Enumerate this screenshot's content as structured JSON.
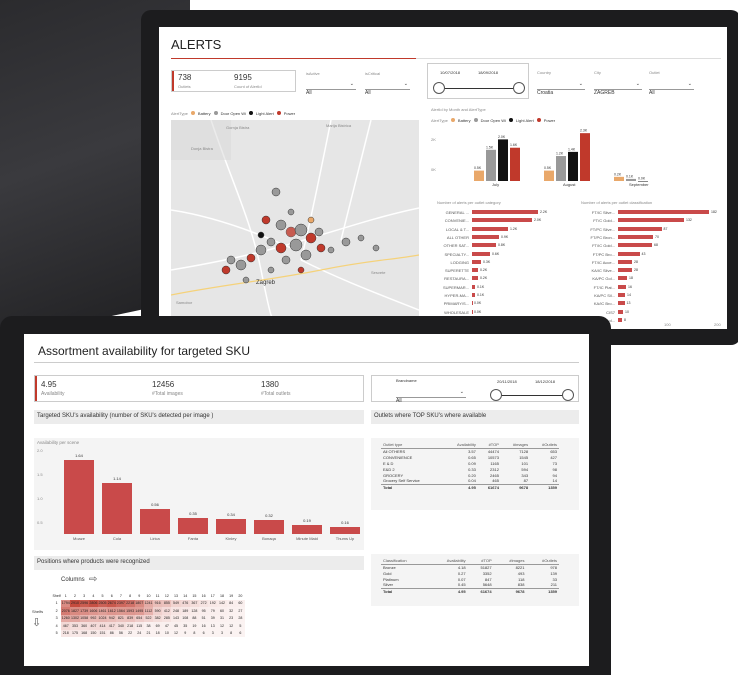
{
  "alerts": {
    "title": "ALERTS",
    "kpi1_value": "738",
    "kpi1_label": "Outlets",
    "kpi2_value": "9195",
    "kpi2_label": "Count of AlertId",
    "filters": [
      {
        "label": "isActive",
        "value": "All"
      },
      {
        "label": "isCritical",
        "value": "All"
      }
    ],
    "date_from": "10/07/2018",
    "date_to": "18/09/2018",
    "country_label": "Country",
    "country_value": "Croatia",
    "city_label": "City",
    "city_value": "ZAGREB",
    "outlet_label": "Outlet",
    "outlet_value": "All",
    "alert_type_label": "AlertType",
    "legend": [
      "Battery",
      "Door Open Wi",
      "Light Alert",
      "Power"
    ],
    "legend_colors": [
      "#e9a86a",
      "#999999",
      "#111111",
      "#c0392b"
    ],
    "map_places": [
      "Gornja Bistra",
      "Donja Bistra",
      "Marija Bistrica",
      "Sesvete",
      "Zagreb",
      "Velika Gorica",
      "Samobor"
    ],
    "month_chart_title": "AlertId by Month and AlertType",
    "months": [
      "July",
      "August",
      "September"
    ],
    "month_values": [
      [
        "0.5K",
        "1.5K",
        "2.0K",
        "1.6K"
      ],
      [
        "0.5K",
        "1.2K",
        "1.4K",
        "2.3K"
      ],
      [
        "0.2K",
        "0.1K",
        "0.0K",
        ""
      ]
    ],
    "month_axis": [
      "2K",
      "0K"
    ],
    "cat_title": "Number of alerts per outlet category",
    "categories": [
      {
        "name": "GENERAL ...",
        "value": 2.2,
        "label": "2.2K"
      },
      {
        "name": "CONVENIE...",
        "value": 2.0,
        "label": "2.0K"
      },
      {
        "name": "LOCAL & T...",
        "value": 1.2,
        "label": "1.2K"
      },
      {
        "name": "ALL OTHER",
        "value": 0.9,
        "label": "0.9K"
      },
      {
        "name": "OTHER SAT...",
        "value": 0.8,
        "label": "0.8K"
      },
      {
        "name": "SPECIALTY...",
        "value": 0.6,
        "label": "0.6K"
      },
      {
        "name": "LODGING",
        "value": 0.3,
        "label": "0.3K"
      },
      {
        "name": "SUPERETTE",
        "value": 0.2,
        "label": "0.2K"
      },
      {
        "name": "RESTAURA...",
        "value": 0.2,
        "label": "0.2K"
      },
      {
        "name": "SUPERMAR...",
        "value": 0.1,
        "label": "0.1K"
      },
      {
        "name": "HYPER-MA...",
        "value": 0.1,
        "label": "0.1K"
      },
      {
        "name": "PRIMARY/S...",
        "value": 0.0,
        "label": "0.0K"
      },
      {
        "name": "WHOLESALE",
        "value": 0.0,
        "label": "0.0K"
      }
    ],
    "class_title": "Number of alerts per outlet classification",
    "classes": [
      {
        "name": "FT/IC Silve...",
        "value": 182,
        "label": "182"
      },
      {
        "name": "FT/C Gold...",
        "value": 132,
        "label": "132"
      },
      {
        "name": "FT/PC Silve...",
        "value": 87,
        "label": "87"
      },
      {
        "name": "FT/PC Bron...",
        "value": 70,
        "label": "70"
      },
      {
        "name": "FT/IC Gold...",
        "value": 68,
        "label": "68"
      },
      {
        "name": "FT/PC Bro...",
        "value": 43,
        "label": "43"
      },
      {
        "name": "FT/IC Acce...",
        "value": 28,
        "label": "28"
      },
      {
        "name": "KA/IC Silve...",
        "value": 28,
        "label": "28"
      },
      {
        "name": "KA/PC Gol...",
        "value": 18,
        "label": "18"
      },
      {
        "name": "FT/IC Plat...",
        "value": 16,
        "label": "16"
      },
      {
        "name": "KA/PC Sil...",
        "value": 14,
        "label": "14"
      },
      {
        "name": "KA/IC Bro...",
        "value": 13,
        "label": "13"
      },
      {
        "name": "CIS7",
        "value": 10,
        "label": "10"
      },
      {
        "name": "KA/IC Gol...",
        "value": 8,
        "label": "8"
      }
    ],
    "class_axis": [
      "100",
      "200"
    ]
  },
  "assort": {
    "title": "Assortment availability for targeted SKU",
    "kpi1_value": "4.95",
    "kpi1_label": "Availability",
    "kpi2_value": "12456",
    "kpi2_label": "#Total images",
    "kpi3_value": "1380",
    "kpi3_label": "#Total outlets",
    "brand_label": "Brandname",
    "brand_value": "All",
    "date_from": "20/11/2018",
    "date_to": "18/12/2018",
    "avail_section": "Targeted SKU's availability (number of SKU's detected per image )",
    "outlets_section": "Outlets where TOP SKU's where available",
    "avail_chart_title": "Availability per scene",
    "y_ticks": [
      "2.0",
      "1.5",
      "1.0",
      "0.5",
      "0.0"
    ],
    "skus": [
      {
        "name": "Moaze",
        "value": 1.64,
        "label": "1.64"
      },
      {
        "name": "Cola",
        "value": 1.14,
        "label": "1.14"
      },
      {
        "name": "Lirica",
        "value": 0.56,
        "label": "0.56"
      },
      {
        "name": "Fanta",
        "value": 0.35,
        "label": "0.35"
      },
      {
        "name": "Kinley",
        "value": 0.34,
        "label": "0.34"
      },
      {
        "name": "Bonaqa",
        "value": 0.32,
        "label": "0.32"
      },
      {
        "name": "Minute Maid",
        "value": 0.19,
        "label": "0.19"
      },
      {
        "name": "Thums Up",
        "value": 0.16,
        "label": "0.16"
      }
    ],
    "positions_section": "Positions where products were recognized",
    "columns_label": "Columns",
    "shelfs_label": "Shelfs",
    "shelf_header": "Shelf",
    "grid_cols": [
      "1",
      "2",
      "3",
      "4",
      "5",
      "6",
      "7",
      "8",
      "9",
      "10",
      "11",
      "12",
      "13",
      "14",
      "15",
      "16",
      "17",
      "18",
      "19",
      "20"
    ],
    "grid_rows": [
      {
        "shelf": "1",
        "values": [
          "1794",
          "2910",
          "2596",
          "2806",
          "2505",
          "2674",
          "2397",
          "2218",
          "1807",
          "1241",
          "916",
          "855",
          "549",
          "476",
          "367",
          "272",
          "192",
          "142",
          "84",
          "60"
        ]
      },
      {
        "shelf": "2",
        "values": [
          "2076",
          "1827",
          "1739",
          "1606",
          "1461",
          "1612",
          "1564",
          "1593",
          "1495",
          "1112",
          "590",
          "412",
          "248",
          "189",
          "128",
          "95",
          "79",
          "60",
          "32",
          "27"
        ]
      },
      {
        "shelf": "3",
        "values": [
          "1260",
          "1302",
          "1058",
          "992",
          "1024",
          "942",
          "821",
          "839",
          "654",
          "522",
          "382",
          "285",
          "143",
          "108",
          "88",
          "51",
          "39",
          "31",
          "23",
          "28"
        ]
      },
      {
        "shelf": "4",
        "values": [
          "467",
          "353",
          "360",
          "407",
          "414",
          "417",
          "340",
          "218",
          "115",
          "38",
          "69",
          "47",
          "45",
          "35",
          "19",
          "16",
          "13",
          "12",
          "12",
          "5"
        ]
      },
      {
        "shelf": "5",
        "values": [
          "218",
          "175",
          "168",
          "150",
          "151",
          "86",
          "56",
          "22",
          "24",
          "21",
          "18",
          "10",
          "12",
          "9",
          "8",
          "6",
          "3",
          "3",
          "8",
          "6"
        ]
      }
    ],
    "table1": {
      "headers": [
        "Outlet type",
        "Availability",
        "#TOP",
        "#images",
        "#Outlets"
      ],
      "rows": [
        [
          "All OTHERS",
          "3.57",
          "44474",
          "7128",
          "653"
        ],
        [
          "CONVENIENCE",
          "0.65",
          "10573",
          "1545",
          "427"
        ],
        [
          "E & D",
          "0.09",
          "1165",
          "101",
          "73"
        ],
        [
          "E&D 2",
          "0.33",
          "2312",
          "594",
          "98"
        ],
        [
          "GROCERY",
          "0.20",
          "2465",
          "343",
          "94"
        ],
        [
          "Grocery Self Service",
          "0.04",
          "465",
          "87",
          "14"
        ]
      ],
      "total": [
        "Total",
        "4.95",
        "61674",
        "9678",
        "1359"
      ]
    },
    "table2": {
      "headers": [
        "Classification",
        "Availability",
        "#TOP",
        "#images",
        "#Outlets"
      ],
      "rows": [
        [
          "Bronze",
          "4.18",
          "51827",
          "8221",
          "978"
        ],
        [
          "Gold",
          "0.27",
          "3352",
          "493",
          "139"
        ],
        [
          "Platinum",
          "0.07",
          "847",
          "118",
          "33"
        ],
        [
          "Silver",
          "0.45",
          "5648",
          "838",
          "211"
        ]
      ],
      "total": [
        "Total",
        "4.95",
        "61674",
        "9678",
        "1359"
      ]
    }
  }
}
